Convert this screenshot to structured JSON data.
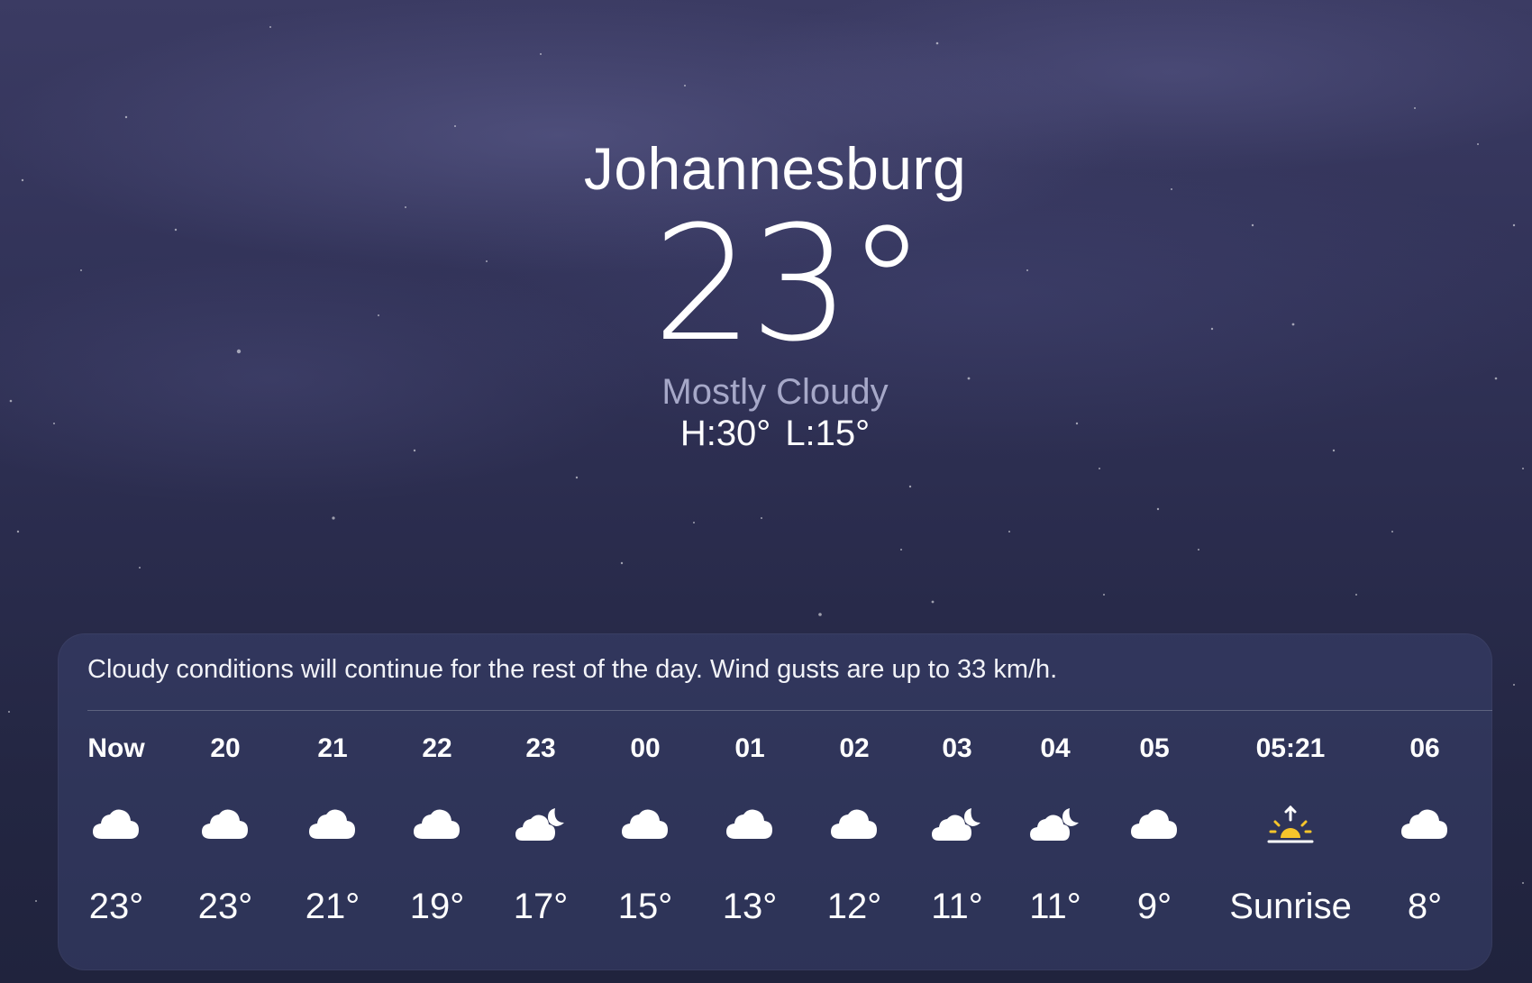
{
  "location": {
    "city": "Johannesburg",
    "temperature": "23°",
    "condition": "Mostly Cloudy",
    "high": "H:30°",
    "low": "L:15°"
  },
  "forecast": {
    "summary": "Cloudy conditions will continue for the rest of the day. Wind gusts are up to 33 km/h.",
    "hours": [
      {
        "time": "Now",
        "icon": "cloud-icon",
        "temp": "23°"
      },
      {
        "time": "20",
        "icon": "cloud-icon",
        "temp": "23°"
      },
      {
        "time": "21",
        "icon": "cloud-icon",
        "temp": "21°"
      },
      {
        "time": "22",
        "icon": "cloud-icon",
        "temp": "19°"
      },
      {
        "time": "23",
        "icon": "cloud-moon-icon",
        "temp": "17°"
      },
      {
        "time": "00",
        "icon": "cloud-icon",
        "temp": "15°"
      },
      {
        "time": "01",
        "icon": "cloud-icon",
        "temp": "13°"
      },
      {
        "time": "02",
        "icon": "cloud-icon",
        "temp": "12°"
      },
      {
        "time": "03",
        "icon": "cloud-moon-icon",
        "temp": "11°"
      },
      {
        "time": "04",
        "icon": "cloud-moon-icon",
        "temp": "11°"
      },
      {
        "time": "05",
        "icon": "cloud-icon",
        "temp": "9°"
      },
      {
        "time": "05:21",
        "icon": "sunrise-icon",
        "temp": "Sunrise"
      },
      {
        "time": "06",
        "icon": "cloud-icon",
        "temp": "8°"
      }
    ]
  },
  "colors": {
    "condition_text": "#a6a8c8",
    "sunrise_sun": "#f7c52b"
  }
}
